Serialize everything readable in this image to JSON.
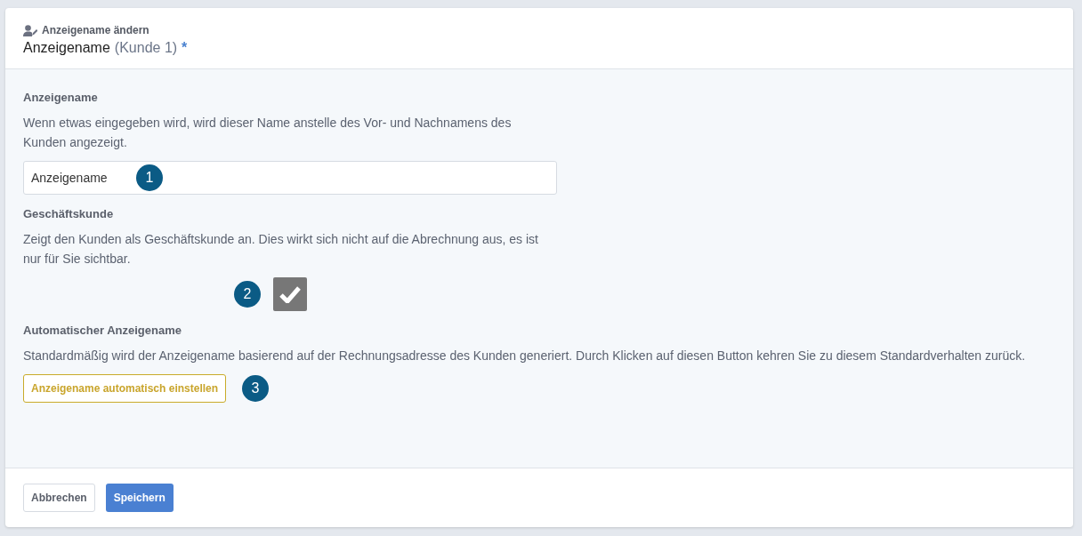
{
  "header": {
    "subtitle": "Anzeigename ändern",
    "title": "Anzeigename",
    "title_context": "(Kunde 1)",
    "required_mark": "*"
  },
  "sections": [
    {
      "kind": "input",
      "heading": "Anzeigename",
      "description": "Wenn etwas eingegeben wird, wird dieser Name anstelle des Vor- und Nachnamens des Kunden angezeigt.",
      "value": "Anzeigename",
      "marker": "1"
    },
    {
      "kind": "checkbox",
      "heading": "Geschäftskunde",
      "description": "Zeigt den Kunden als Geschäftskunde an. Dies wirkt sich nicht auf die Abrechnung aus, es ist nur für Sie sichtbar.",
      "checked": true,
      "marker": "2"
    },
    {
      "kind": "button",
      "heading": "Automatischer Anzeigename",
      "description": "Standardmäßig wird der Anzeigename basierend auf der Rechnungsadresse des Kunden generiert. Durch Klicken auf diesen Button kehren Sie zu diesem Standardverhalten zurück.",
      "button": "Anzeigename automatisch einstellen",
      "marker": "3"
    }
  ],
  "footer": {
    "cancel": "Abbrechen",
    "save": "Speichern"
  }
}
